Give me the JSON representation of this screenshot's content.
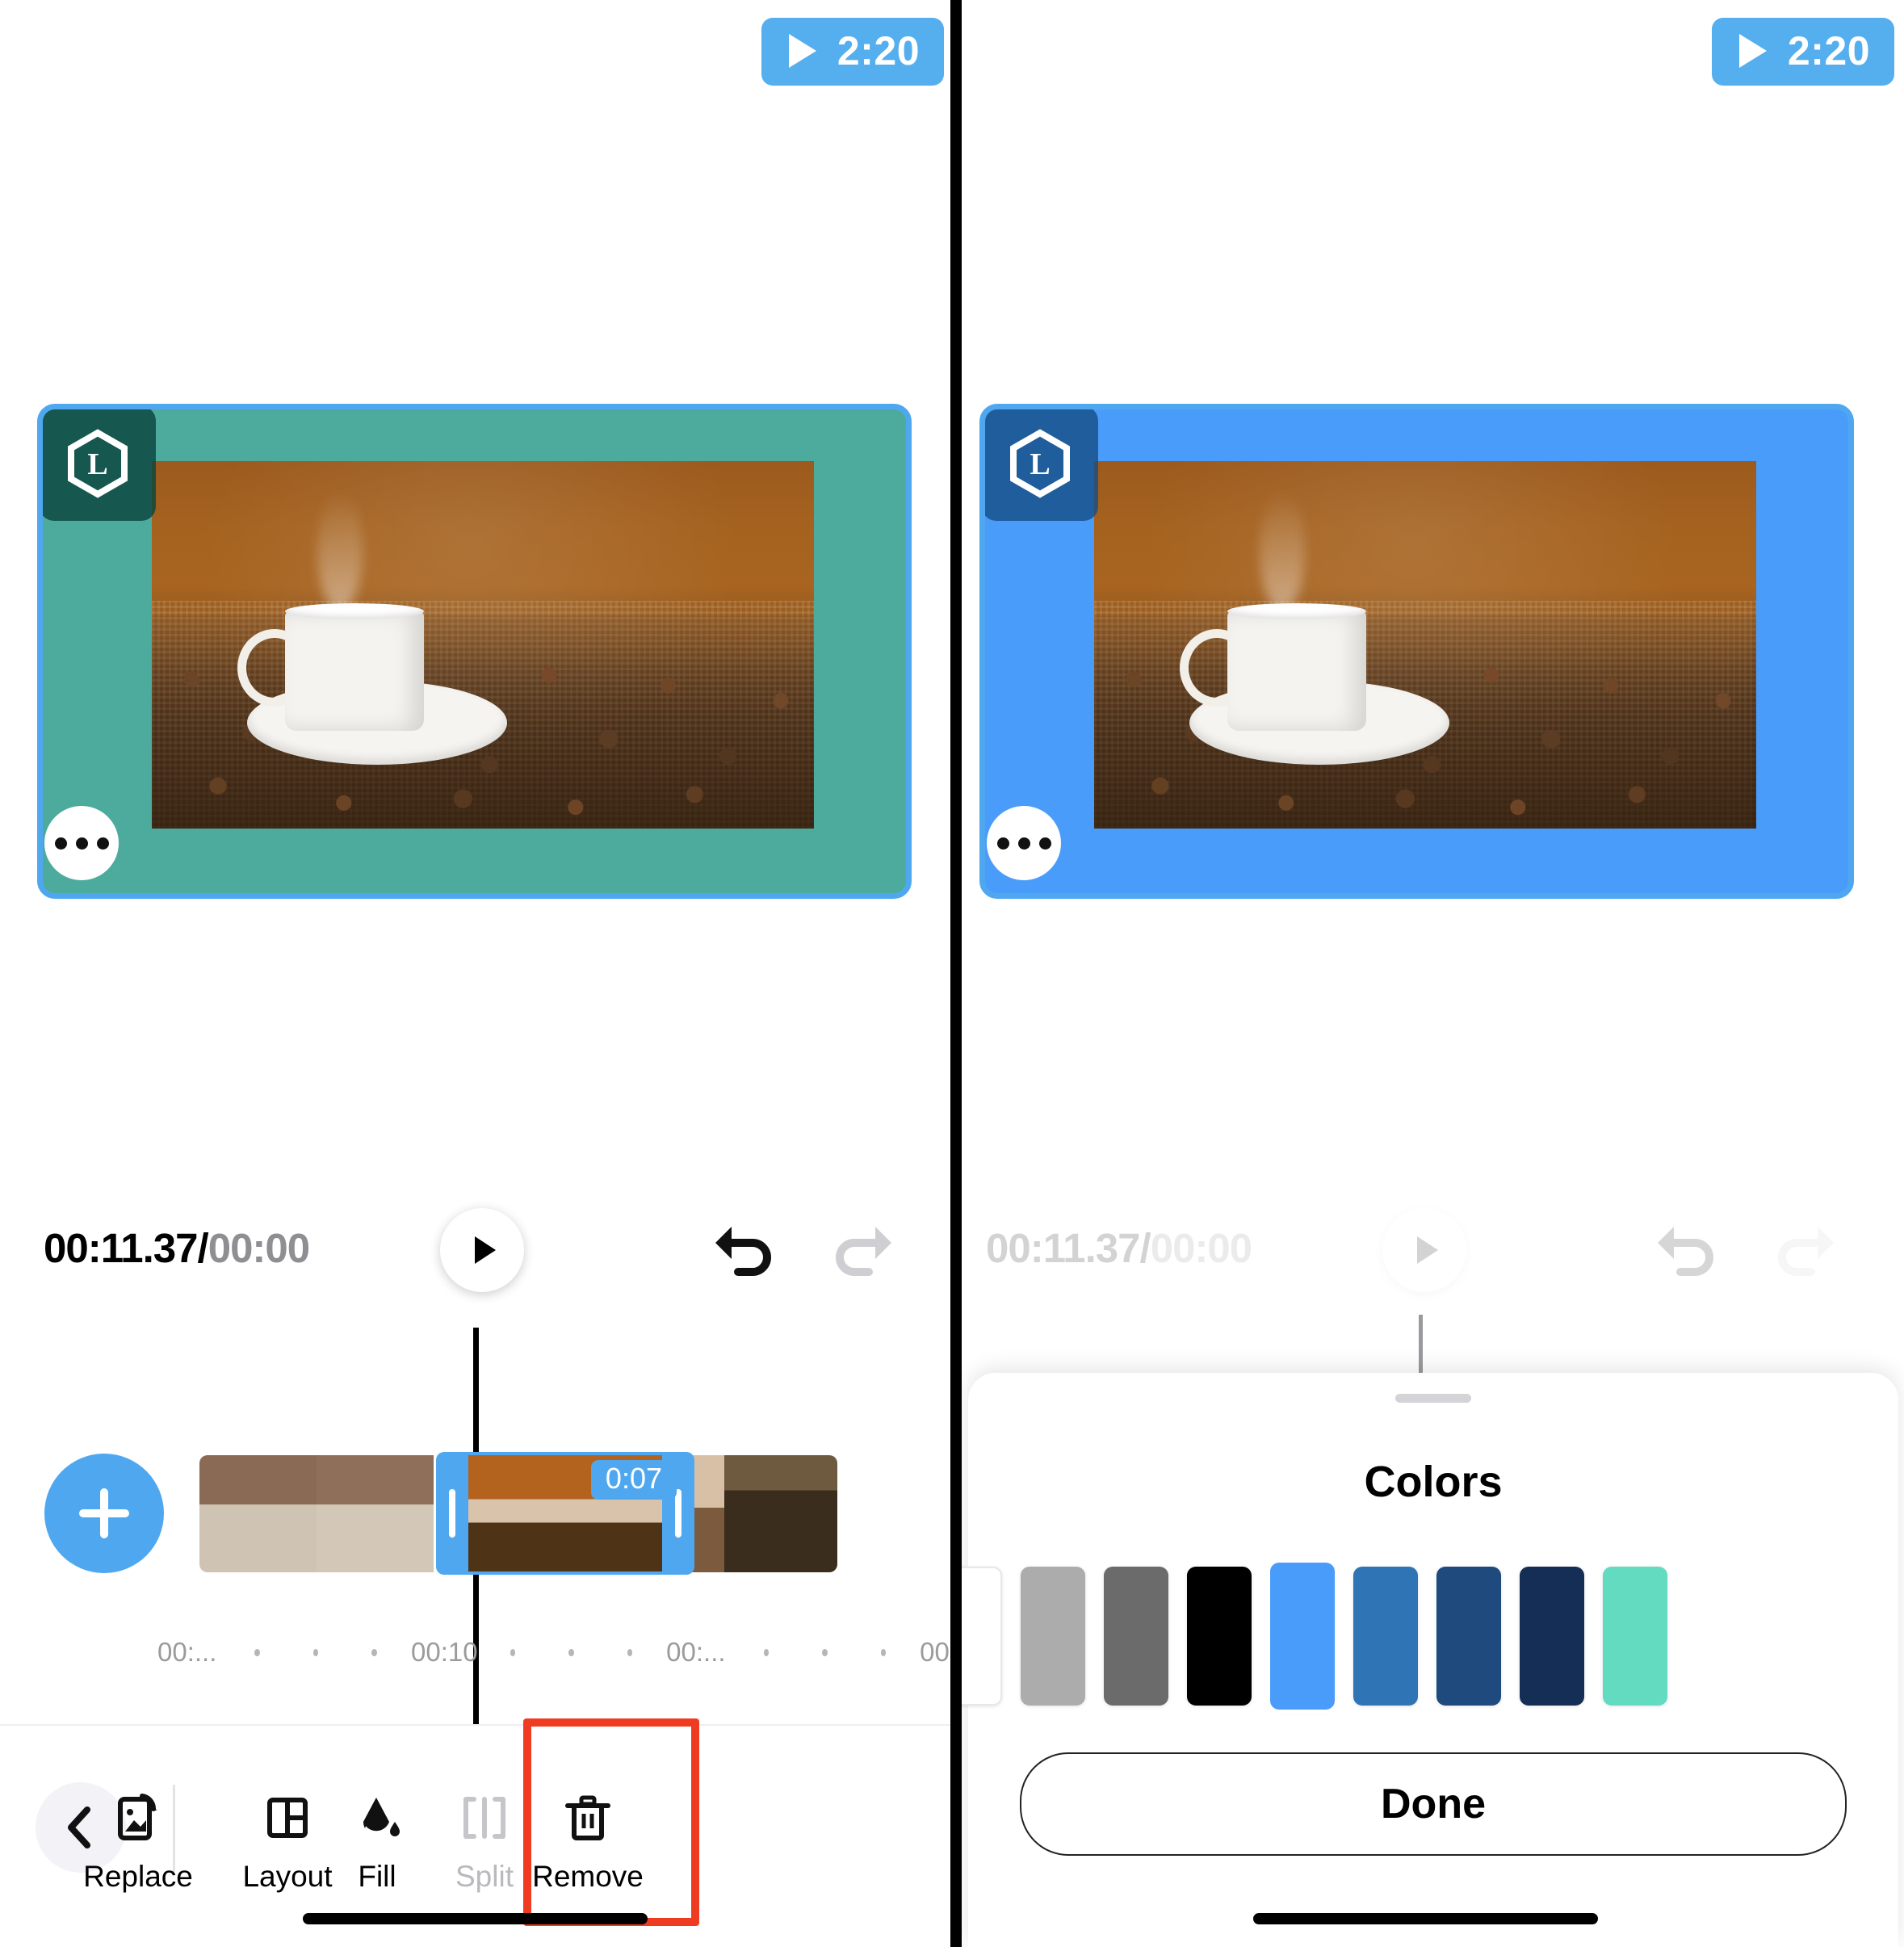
{
  "app": {
    "duration_badge": {
      "label": "2:20",
      "icon": "play-icon",
      "bg": "#55aeee"
    },
    "watermark": {
      "letter": "L",
      "icon": "hexagon-logo-icon"
    }
  },
  "left_panel": {
    "canvas": {
      "fill_color": "#4DAB9E",
      "fill_color_name": "teal",
      "selection_border": "#4fa8ef"
    },
    "more_button": {
      "icon": "ellipsis-icon"
    },
    "playback": {
      "current_time": "00:11.37",
      "separator": "/",
      "total_time": "00:00",
      "play_icon": "play-icon",
      "undo_icon": "undo-icon",
      "redo_icon": "redo-icon"
    },
    "timeline": {
      "add_button_icon": "plus-icon",
      "selected_clip_duration": "0:07",
      "ruler_labels": [
        "00:...",
        "00:10",
        "00:...",
        "00:"
      ]
    },
    "toolbar": {
      "back_icon": "chevron-left-icon",
      "items": [
        {
          "label": "Replace",
          "icon": "replace-image-icon",
          "disabled": false
        },
        {
          "label": "Layout",
          "icon": "layout-grid-icon",
          "disabled": false
        },
        {
          "label": "Fill",
          "icon": "paint-bucket-icon",
          "disabled": false,
          "highlighted": true
        },
        {
          "label": "Split",
          "icon": "split-icon",
          "disabled": true
        },
        {
          "label": "Remove",
          "icon": "trash-icon",
          "disabled": false
        }
      ],
      "highlight_color": "#ef3b21"
    }
  },
  "right_panel": {
    "canvas": {
      "fill_color": "#4A9CFB",
      "fill_color_name": "blue",
      "selection_border": "#4fa8ef"
    },
    "more_button": {
      "icon": "ellipsis-icon"
    },
    "playback": {
      "current_time": "00:11.37",
      "separator": "/",
      "total_time": "00:00",
      "play_icon": "play-icon",
      "undo_icon": "undo-icon",
      "redo_icon": "redo-icon"
    },
    "color_sheet": {
      "title": "Colors",
      "grabber": "sheet-grabber",
      "done_label": "Done",
      "swatches": [
        {
          "name": "white",
          "hex": "#FFFFFF",
          "selected": false
        },
        {
          "name": "light-gray",
          "hex": "#ACACAC",
          "selected": false
        },
        {
          "name": "dark-gray",
          "hex": "#6B6B6B",
          "selected": false
        },
        {
          "name": "black",
          "hex": "#000000",
          "selected": false
        },
        {
          "name": "sky-blue",
          "hex": "#4A9CFB",
          "selected": true
        },
        {
          "name": "medium-blue",
          "hex": "#2F74B5",
          "selected": false
        },
        {
          "name": "navy-blue",
          "hex": "#1E4A7D",
          "selected": false
        },
        {
          "name": "dark-navy",
          "hex": "#152E55",
          "selected": false
        },
        {
          "name": "mint-teal",
          "hex": "#63DBC0",
          "selected": false
        }
      ]
    }
  }
}
